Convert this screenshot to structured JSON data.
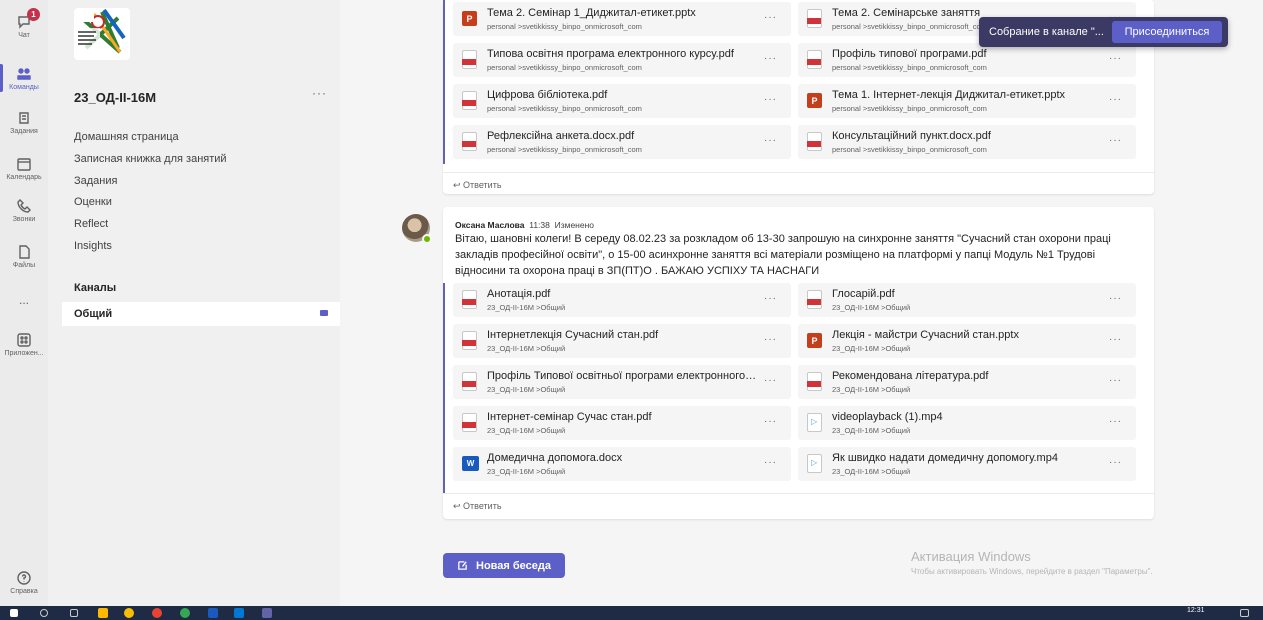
{
  "rail": {
    "items": [
      {
        "label": "Чат",
        "icon": "chat-icon",
        "badge": "1"
      },
      {
        "label": "Команды",
        "icon": "teams-icon",
        "active": true
      },
      {
        "label": "Задания",
        "icon": "assignments-icon"
      },
      {
        "label": "Календарь",
        "icon": "calendar-icon"
      },
      {
        "label": "Звонки",
        "icon": "calls-icon"
      },
      {
        "label": "Файлы",
        "icon": "files-icon"
      },
      {
        "label": "...",
        "icon": "more-icon"
      },
      {
        "label": "Приложен...",
        "icon": "apps-icon"
      }
    ],
    "help_label": "Справка"
  },
  "team": {
    "name": "23_ОД-ІІ-16М",
    "more": "···",
    "nav": [
      "Домашняя страница",
      "Записная книжка для занятий",
      "Задания",
      "Оценки",
      "Reflect",
      "Insights"
    ],
    "channels_header": "Каналы",
    "channel": "Общий"
  },
  "top_card": {
    "files": [
      {
        "name": "Тема 2. Семінар 1_Диджитал-етикет.pptx",
        "path": "personal >svetikkissy_binpo_onmicrosoft_com",
        "type": "ppt"
      },
      {
        "name": "Тема 2. Семінарське заняття",
        "path": "personal >svetikkissy_binpo_onmicrosoft_com",
        "type": "pdf"
      },
      {
        "name": "Типова освітня програма електронного курсу.pdf",
        "path": "personal >svetikkissy_binpo_onmicrosoft_com",
        "type": "pdf"
      },
      {
        "name": "Профіль типової програми.pdf",
        "path": "personal >svetikkissy_binpo_onmicrosoft_com",
        "type": "pdf"
      },
      {
        "name": "Цифрова бібліотека.pdf",
        "path": "personal >svetikkissy_binpo_onmicrosoft_com",
        "type": "pdf"
      },
      {
        "name": "Тема 1. Інтернет-лекція Диджитал-етикет.pptx",
        "path": "personal >svetikkissy_binpo_onmicrosoft_com",
        "type": "ppt"
      },
      {
        "name": "Рефлексійна анкета.docx.pdf",
        "path": "personal >svetikkissy_binpo_onmicrosoft_com",
        "type": "pdf"
      },
      {
        "name": "Консультаційний пункт.docx.pdf",
        "path": "personal >svetikkissy_binpo_onmicrosoft_com",
        "type": "pdf"
      }
    ],
    "reply": "Ответить"
  },
  "message": {
    "author": "Оксана Маслова",
    "time": "11:38",
    "edited": "Изменено",
    "body": "Вітаю, шановні колеги! В середу 08.02.23 за розкладом об 13-30 запрошую на синхронне заняття \"Сучасний стан охорони праці закладів професійної освіти\", о 15-00 асинхронне заняття всі матеріали розміщено на платформі у папці Модуль №1 Трудові відносини та охорона праці в ЗП(ПТ)О . БАЖАЮ УСПІХУ ТА НАСНАГИ",
    "files": [
      {
        "name": "Анотація.pdf",
        "path": "23_ОД-ІІ-16М >Общий",
        "type": "pdf"
      },
      {
        "name": "Глосарій.pdf",
        "path": "23_ОД-ІІ-16М >Общий",
        "type": "pdf"
      },
      {
        "name": "Інтернетлекція Сучасний стан.pdf",
        "path": "23_ОД-ІІ-16М >Общий",
        "type": "pdf"
      },
      {
        "name": "Лекція - майстри Сучасний стан.pptx",
        "path": "23_ОД-ІІ-16М >Общий",
        "type": "ppt"
      },
      {
        "name": "Профіль Типової освітньої програми електронного курсу.pdf",
        "path": "23_ОД-ІІ-16М >Общий",
        "type": "pdf"
      },
      {
        "name": "Рекомендована література.pdf",
        "path": "23_ОД-ІІ-16М >Общий",
        "type": "pdf"
      },
      {
        "name": "Інтернет-семінар Сучас стан.pdf",
        "path": "23_ОД-ІІ-16М >Общий",
        "type": "pdf"
      },
      {
        "name": "videoplayback (1).mp4",
        "path": "23_ОД-ІІ-16М >Общий",
        "type": "vid"
      },
      {
        "name": "Домедична допомога.docx",
        "path": "23_ОД-ІІ-16М >Общий",
        "type": "doc"
      },
      {
        "name": "Як швидко надати домедичну допомогу.mp4",
        "path": "23_ОД-ІІ-16М >Общий",
        "type": "vid"
      }
    ],
    "reply": "Ответить"
  },
  "new_chat_label": "Новая беседа",
  "toast": {
    "text": "Собрание в канале \"...",
    "button": "Присоединиться"
  },
  "activation": {
    "title": "Активация Windows",
    "subtitle": "Чтобы активировать Windows, перейдите в раздел \"Параметры\"."
  },
  "taskbar": {
    "time": "12:31"
  },
  "colors": {
    "accent": "#5b5fc7",
    "toast": "#3b3a65",
    "taskbar": "#1f2a44"
  }
}
